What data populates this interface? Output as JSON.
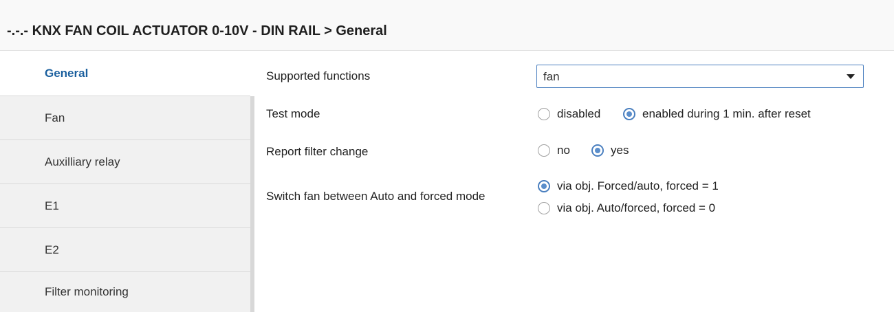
{
  "header": {
    "title": "-.-.- KNX FAN COIL ACTUATOR 0-10V - DIN RAIL > General"
  },
  "sidebar": {
    "items": [
      {
        "label": "General",
        "active": true
      },
      {
        "label": "Fan",
        "active": false
      },
      {
        "label": "Auxilliary relay",
        "active": false
      },
      {
        "label": "E1",
        "active": false
      },
      {
        "label": "E2",
        "active": false
      },
      {
        "label": "Filter monitoring",
        "active": false
      }
    ]
  },
  "settings": {
    "supported_functions": {
      "label": "Supported functions",
      "value": "fan"
    },
    "test_mode": {
      "label": "Test mode",
      "options": [
        {
          "label": "disabled",
          "checked": false
        },
        {
          "label": "enabled during 1 min. after reset",
          "checked": true
        }
      ]
    },
    "report_filter_change": {
      "label": "Report filter change",
      "options": [
        {
          "label": "no",
          "checked": false
        },
        {
          "label": "yes",
          "checked": true
        }
      ]
    },
    "switch_fan_mode": {
      "label": "Switch fan between Auto and forced mode",
      "options": [
        {
          "label": "via obj. Forced/auto, forced = 1",
          "checked": true
        },
        {
          "label": "via obj. Auto/forced, forced = 0",
          "checked": false
        }
      ]
    }
  },
  "colors": {
    "accent": "#4a7fbf",
    "active_tab_text": "#1a5f9e",
    "sidebar_bg": "#f1f1f1",
    "header_bg": "#f9f9f9"
  }
}
